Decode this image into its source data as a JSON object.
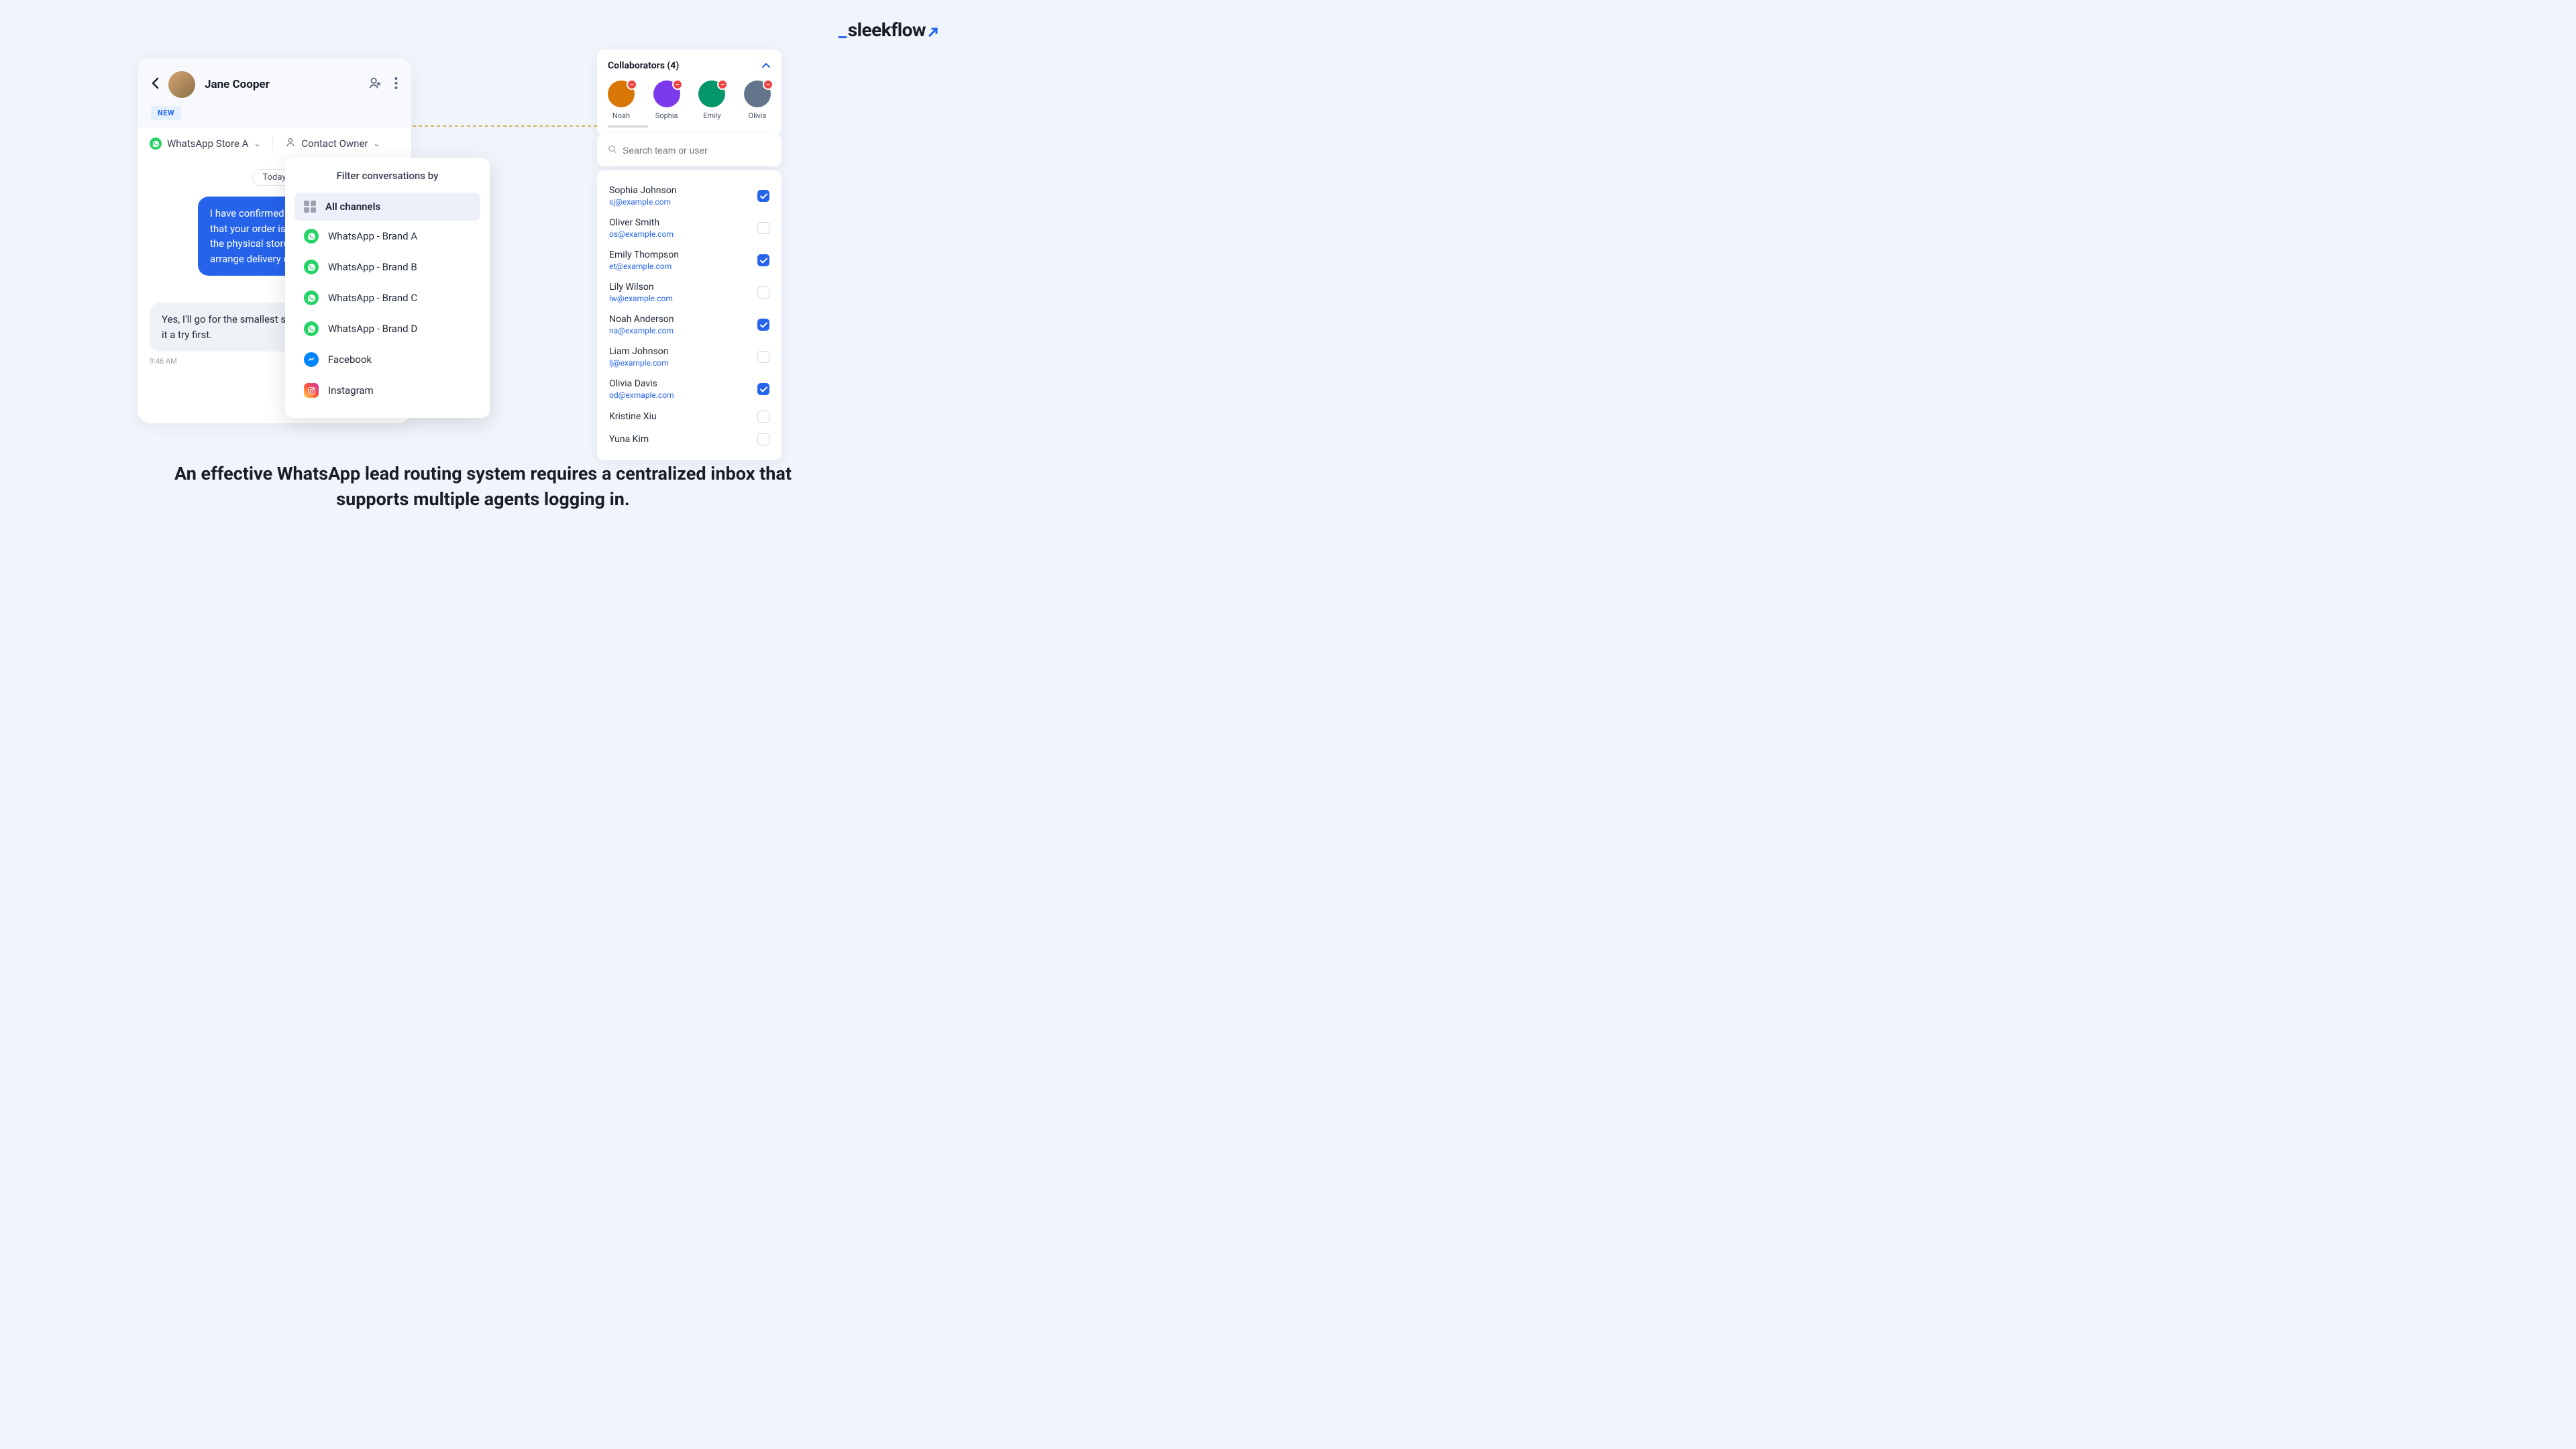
{
  "logo": {
    "text": "sleekflow"
  },
  "chat": {
    "contact_name": "Jane Cooper",
    "new_badge": "NEW",
    "channel_filter": "WhatsApp Store A",
    "owner_filter": "Contact Owner",
    "date_label": "Today",
    "msg_out": "I have confirmed with the store staff that your order is ready for pickup at the physical store. Would you like me to arrange delivery or in-store pickup?",
    "msg_in": "Yes, I'll go for the smallest size first and give it a try first.",
    "msg_in_time": "9:46 AM"
  },
  "filter_dropdown": {
    "title": "Filter conversations by",
    "items": [
      {
        "label": "All channels",
        "type": "all",
        "selected": true
      },
      {
        "label": "WhatsApp - Brand A",
        "type": "whatsapp"
      },
      {
        "label": "WhatsApp - Brand B",
        "type": "whatsapp"
      },
      {
        "label": "WhatsApp - Brand C",
        "type": "whatsapp"
      },
      {
        "label": "WhatsApp - Brand D",
        "type": "whatsapp"
      },
      {
        "label": "Facebook",
        "type": "facebook"
      },
      {
        "label": "Instagram",
        "type": "instagram"
      }
    ]
  },
  "collaborators": {
    "title": "Collaborators (4)",
    "people": [
      {
        "name": "Noah",
        "color": "#d97706"
      },
      {
        "name": "Sophia",
        "color": "#7c3aed"
      },
      {
        "name": "Emily",
        "color": "#059669"
      },
      {
        "name": "Olivia",
        "color": "#64748b"
      }
    ]
  },
  "search": {
    "placeholder": "Search team or user"
  },
  "users": [
    {
      "name": "Sophia Johnson",
      "email": "sj@example.com",
      "checked": true
    },
    {
      "name": "Oliver Smith",
      "email": "os@example.com",
      "checked": false
    },
    {
      "name": "Emily Thompson",
      "email": "et@example.com",
      "checked": true
    },
    {
      "name": "Lily Wilson",
      "email": "lw@example.com",
      "checked": false
    },
    {
      "name": "Noah Anderson",
      "email": "na@example.com",
      "checked": true
    },
    {
      "name": "Liam Johnson",
      "email": "lj@example.com",
      "checked": false
    },
    {
      "name": "Olivia Davis",
      "email": "od@exmaple.com",
      "checked": true
    },
    {
      "name": "Kristine Xiu",
      "email": "",
      "checked": false
    },
    {
      "name": "Yuna Kim",
      "email": "",
      "checked": false
    }
  ],
  "caption": "An effective WhatsApp lead routing system requires a centralized inbox that supports multiple agents logging in."
}
